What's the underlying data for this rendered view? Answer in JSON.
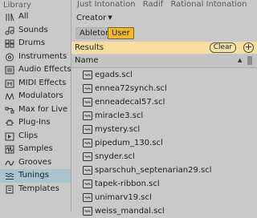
{
  "sidebar": {
    "title": "Library",
    "items": [
      {
        "label": "All",
        "icon": "all-icon"
      },
      {
        "label": "Sounds",
        "icon": "sounds-icon"
      },
      {
        "label": "Drums",
        "icon": "drums-icon"
      },
      {
        "label": "Instruments",
        "icon": "instruments-icon"
      },
      {
        "label": "Audio Effects",
        "icon": "audio-effects-icon"
      },
      {
        "label": "MIDI Effects",
        "icon": "midi-effects-icon"
      },
      {
        "label": "Modulators",
        "icon": "modulators-icon"
      },
      {
        "label": "Max for Live",
        "icon": "max-for-live-icon"
      },
      {
        "label": "Plug-Ins",
        "icon": "plug-ins-icon"
      },
      {
        "label": "Clips",
        "icon": "clips-icon"
      },
      {
        "label": "Samples",
        "icon": "samples-icon"
      },
      {
        "label": "Grooves",
        "icon": "grooves-icon"
      },
      {
        "label": "Tunings",
        "icon": "tunings-icon",
        "selected": true
      },
      {
        "label": "Templates",
        "icon": "templates-icon"
      }
    ]
  },
  "main": {
    "tabs": [
      "Just Intonation",
      "Radif",
      "Rational Intonation"
    ],
    "filter": {
      "label": "Creator",
      "chips": [
        {
          "label": "Ableton",
          "active": false
        },
        {
          "label": "User",
          "active": true
        }
      ]
    },
    "results": {
      "label": "Results",
      "clear_label": "Clear",
      "add_label": "+"
    },
    "column": {
      "name": "Name",
      "sort_glyph": "▲"
    },
    "files": [
      "egads.scl",
      "ennea72synch.scl",
      "enneadecal57.scl",
      "miracle3.scl",
      "mystery.scl",
      "pipedum_130.scl",
      "snyder.scl",
      "sparschuh_septenarian29.scl",
      "tapek-ribbon.scl",
      "unimarv19.scl",
      "weiss_mandal.scl"
    ]
  },
  "colors": {
    "accent": "#f4b92b",
    "results_bg": "#f7de9f",
    "selected_bg": "#a9c4cf"
  }
}
